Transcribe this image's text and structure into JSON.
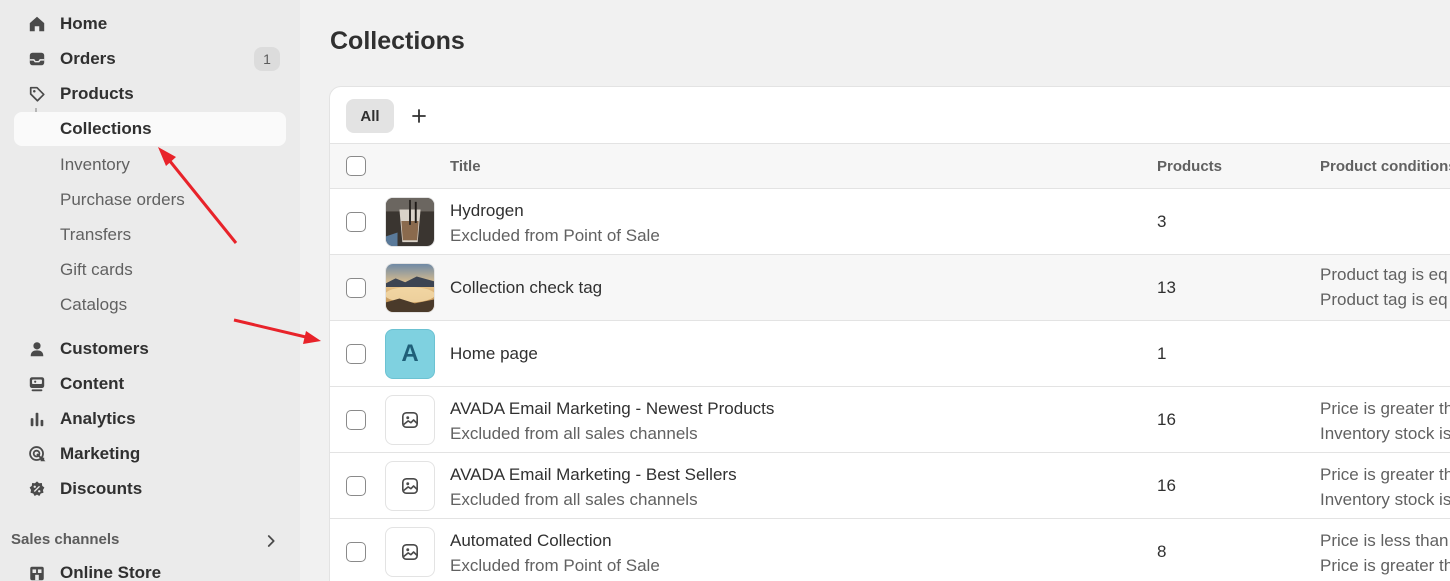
{
  "sidebar": {
    "nav": [
      {
        "label": "Home",
        "icon": "home-icon"
      },
      {
        "label": "Orders",
        "icon": "inbox-icon",
        "badge": "1"
      },
      {
        "label": "Products",
        "icon": "tag-icon"
      },
      {
        "label": "Collections",
        "active": true
      },
      {
        "label": "Inventory"
      },
      {
        "label": "Purchase orders"
      },
      {
        "label": "Transfers"
      },
      {
        "label": "Gift cards"
      },
      {
        "label": "Catalogs"
      },
      {
        "label": "Customers",
        "icon": "person-icon"
      },
      {
        "label": "Content",
        "icon": "content-icon"
      },
      {
        "label": "Analytics",
        "icon": "bar-chart-icon"
      },
      {
        "label": "Marketing",
        "icon": "target-icon"
      },
      {
        "label": "Discounts",
        "icon": "discount-icon"
      }
    ],
    "sales_channels_title": "Sales channels",
    "online_store": "Online Store"
  },
  "main": {
    "page_title": "Collections",
    "tabs": {
      "all": "All",
      "add": "+"
    },
    "columns": {
      "title": "Title",
      "products": "Products",
      "conditions": "Product conditions"
    },
    "rows": [
      {
        "title": "Hydrogen",
        "subtitle": "Excluded from Point of Sale",
        "count": "3",
        "conditions": [
          "",
          ""
        ],
        "thumb": "photo-drink"
      },
      {
        "title": "Collection check tag",
        "subtitle": "",
        "count": "13",
        "conditions": [
          "Product tag is eq",
          "Product tag is eq"
        ],
        "thumb": "photo-landscape"
      },
      {
        "title": "Home page",
        "subtitle": "",
        "count": "1",
        "conditions": [
          "",
          ""
        ],
        "thumb": "letter",
        "letter": "A"
      },
      {
        "title": "AVADA Email Marketing - Newest Products",
        "subtitle": "Excluded from all sales channels",
        "count": "16",
        "conditions": [
          "Price is greater th",
          "Inventory stock is"
        ],
        "thumb": "placeholder"
      },
      {
        "title": "AVADA Email Marketing - Best Sellers",
        "subtitle": "Excluded from all sales channels",
        "count": "16",
        "conditions": [
          "Price is greater th",
          "Inventory stock is"
        ],
        "thumb": "placeholder"
      },
      {
        "title": "Automated Collection",
        "subtitle": "Excluded from Point of Sale",
        "count": "8",
        "conditions": [
          "Price is less than",
          "Price is greater th"
        ],
        "thumb": "placeholder"
      }
    ]
  },
  "colors": {
    "sidebar_bg": "#ebebeb",
    "page_bg": "#f1f1f1",
    "annotation_arrow": "#e8232a",
    "letter_thumb": "#7fd1e0"
  }
}
